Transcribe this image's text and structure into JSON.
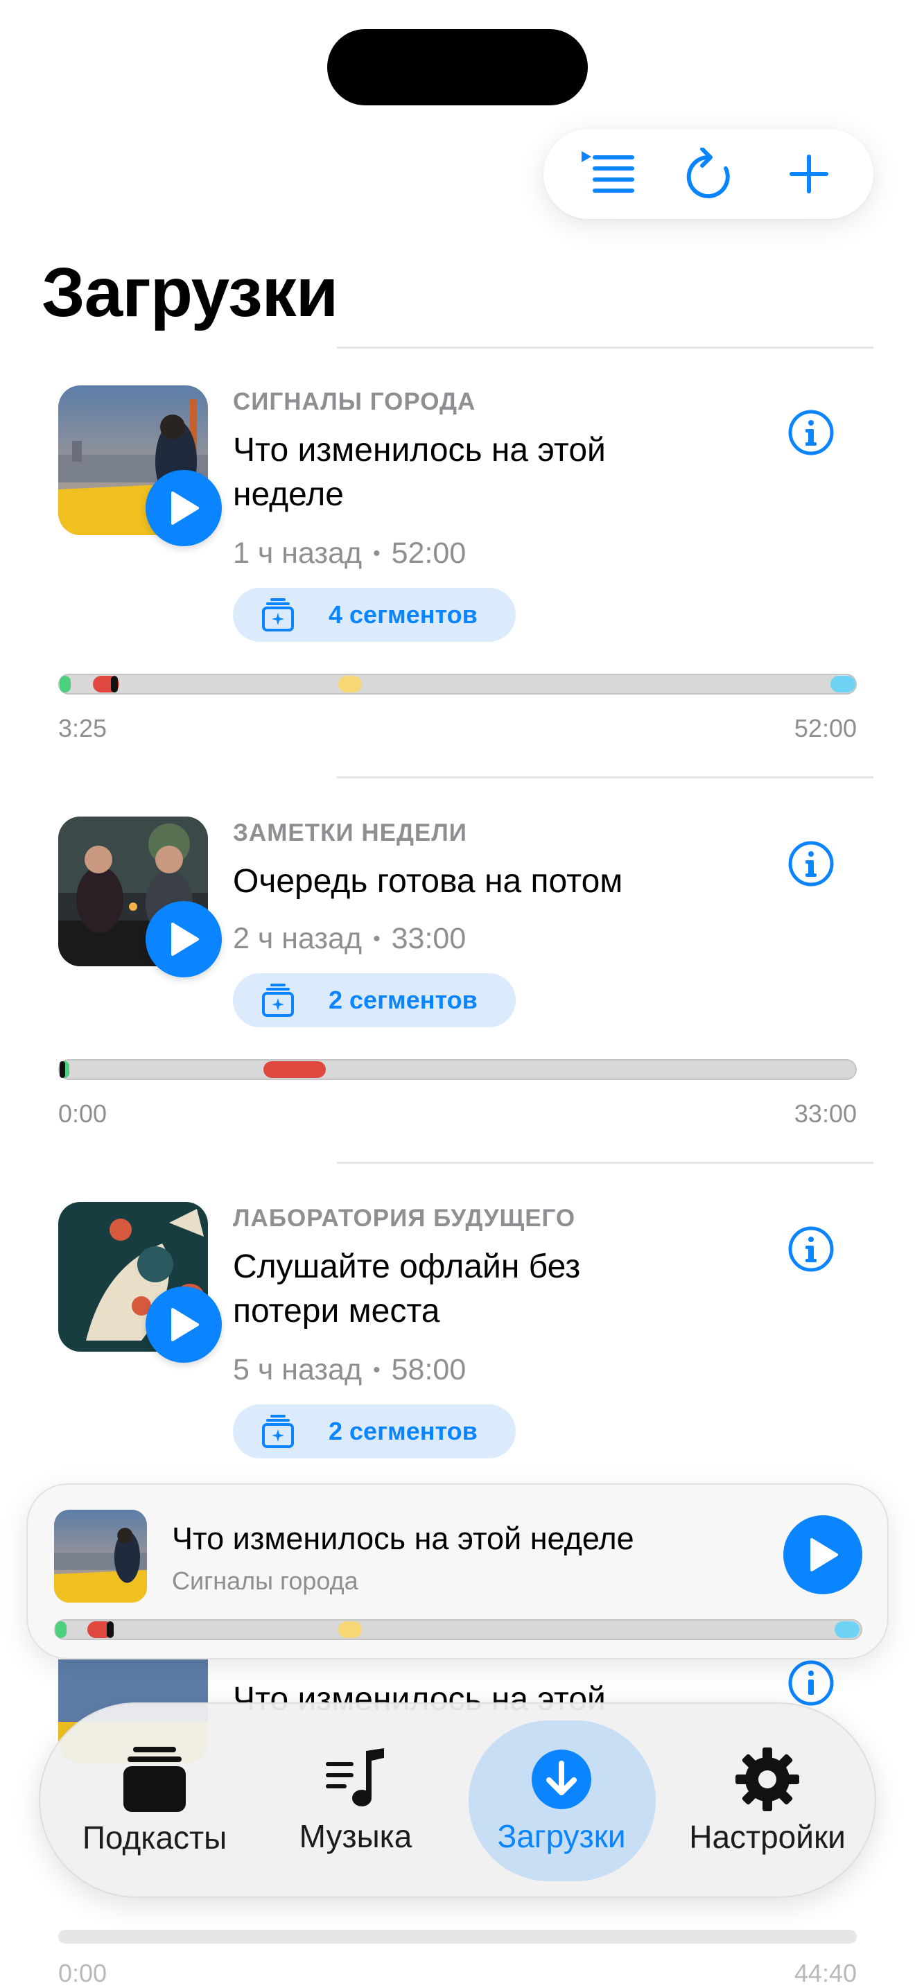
{
  "page": {
    "title": "Загрузки"
  },
  "toolbar": {
    "queue_icon": "list-with-play-icon",
    "refresh_icon": "refresh-icon",
    "add_icon": "plus-icon"
  },
  "episodes": [
    {
      "show": "СИГНАЛЫ ГОРОДА",
      "title": "Что изменилось на этой неделе",
      "ago": "1 ч назад",
      "duration": "52:00",
      "segments_label": "4 сегментов",
      "elapsed": "3:25",
      "total": "52:00",
      "progress_fraction": 0.066
    },
    {
      "show": "ЗАМЕТКИ НЕДЕЛИ",
      "title": "Очередь готова на потом",
      "ago": "2 ч назад",
      "duration": "33:00",
      "segments_label": "2 сегментов",
      "elapsed": "0:00",
      "total": "33:00",
      "progress_fraction": 0.0
    },
    {
      "show": "ЛАБОРАТОРИЯ БУДУЩЕГО",
      "title": "Слушайте офлайн без потери места",
      "ago": "5 ч назад",
      "duration": "58:00",
      "segments_label": "2 сегментов"
    }
  ],
  "mini_player": {
    "title": "Что изменилось на этой неделе",
    "show": "Сигналы города"
  },
  "peek": {
    "title": "Что изменилось на этой",
    "elapsed": "0:00",
    "total": "44:40"
  },
  "tabs": [
    {
      "label": "Подкасты",
      "icon": "podcasts-stack-icon"
    },
    {
      "label": "Музыка",
      "icon": "music-note-list-icon"
    },
    {
      "label": "Загрузки",
      "icon": "download-circle-icon",
      "active": true
    },
    {
      "label": "Настройки",
      "icon": "gear-icon"
    }
  ],
  "colors": {
    "accent": "#0a84ff",
    "segment_green": "#4cd07d",
    "segment_red": "#e0473f",
    "segment_yellow": "#f7d774",
    "segment_cyan": "#6fd3f5"
  }
}
